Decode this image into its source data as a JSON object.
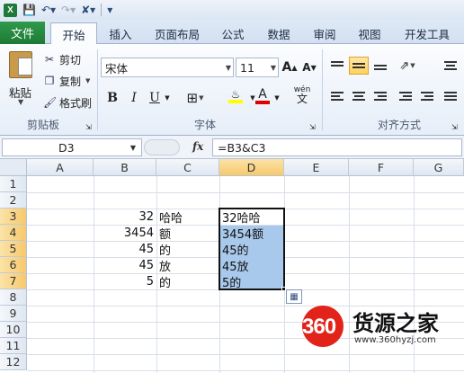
{
  "title_bar": {
    "app_icon_label": "X",
    "qat": {
      "save_icon": "save-icon",
      "undo_icon": "undo-icon",
      "redo_icon": "redo-icon"
    }
  },
  "tabs": {
    "file": "文件",
    "items": [
      "开始",
      "插入",
      "页面布局",
      "公式",
      "数据",
      "审阅",
      "视图",
      "开发工具"
    ],
    "active": "开始"
  },
  "ribbon": {
    "clipboard": {
      "paste": "粘贴",
      "cut": "剪切",
      "copy": "复制",
      "format_painter": "格式刷",
      "group": "剪贴板"
    },
    "font": {
      "name": "宋体",
      "size": "11",
      "bold": "B",
      "italic": "I",
      "underline": "U",
      "group": "字体",
      "grow": "A",
      "shrink": "A",
      "font_color_glyph": "A",
      "fill_color": "#ffff00",
      "text_color": "#e00000",
      "wen": "wén"
    },
    "alignment": {
      "group": "对齐方式"
    }
  },
  "formula_bar": {
    "name_box": "D3",
    "fx": "fx",
    "formula": "=B3&C3"
  },
  "sheet": {
    "columns": [
      "A",
      "B",
      "C",
      "D",
      "E",
      "F",
      "G"
    ],
    "rows": [
      "1",
      "2",
      "3",
      "4",
      "5",
      "6",
      "7",
      "8",
      "9",
      "10",
      "11",
      "12"
    ],
    "selected_column": "D",
    "selected_rows": [
      "3",
      "4",
      "5",
      "6",
      "7"
    ],
    "cells": {
      "B3": "32",
      "C3": "哈哈",
      "D3": "32哈哈",
      "B4": "3454",
      "C4": "额",
      "D4": "3454额",
      "B5": "45",
      "C5": "的",
      "D5": "45的",
      "B6": "45",
      "C6": "放",
      "D6": "45放",
      "B7": "5",
      "C7": "的",
      "D7": "5的"
    }
  },
  "watermark": {
    "number": "360",
    "brand": "货源之家",
    "url": "www.360hyzj.com"
  }
}
